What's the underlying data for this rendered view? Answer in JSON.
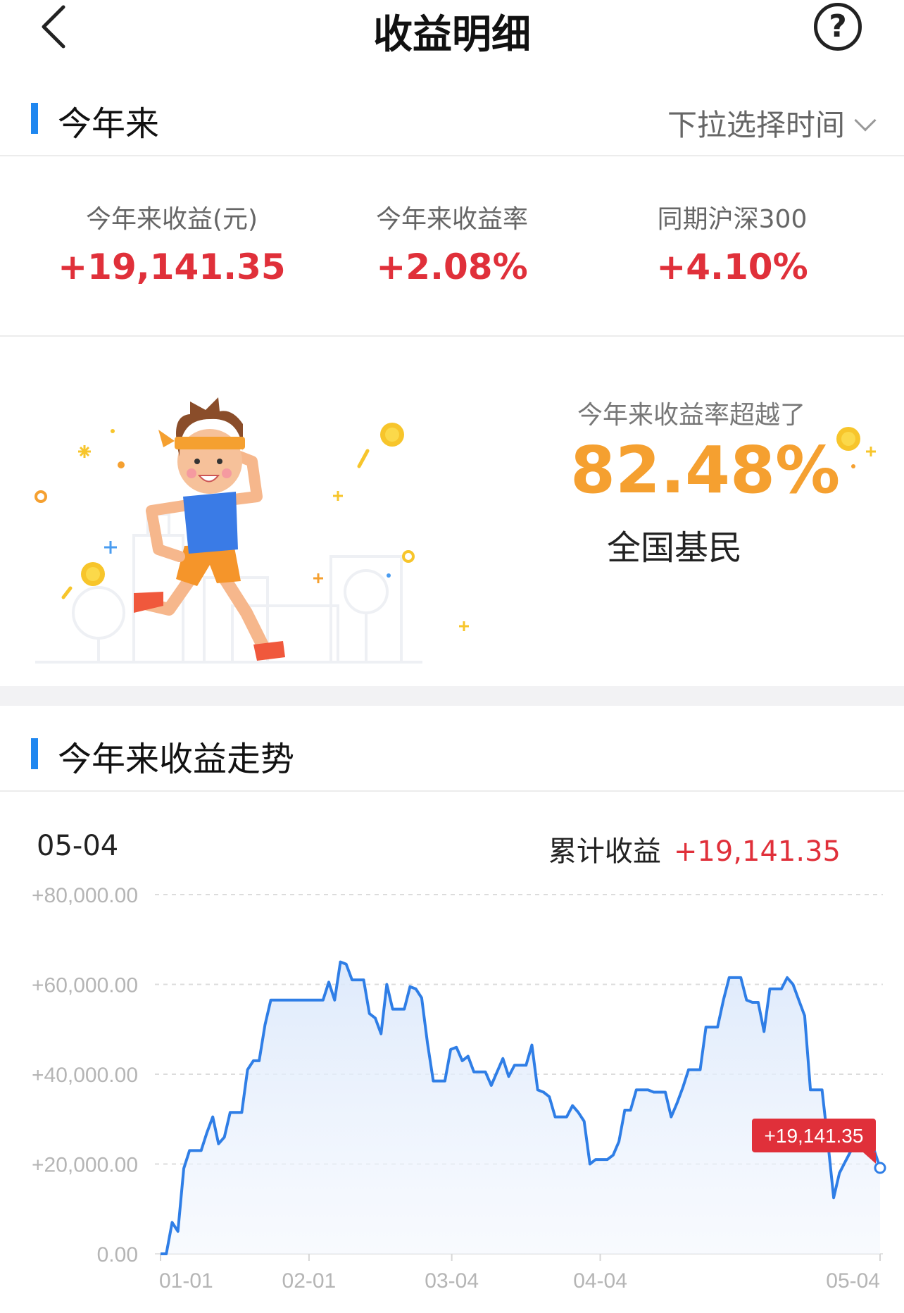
{
  "nav": {
    "title": "收益明细",
    "help_icon": "question-circle-icon",
    "back_icon": "chevron-left-icon"
  },
  "period": {
    "title": "今年来",
    "dropdown_label": "下拉选择时间"
  },
  "stats": [
    {
      "label": "今年来收益(元)",
      "value": "+19,141.35"
    },
    {
      "label": "今年来收益率",
      "value": "+2.08%"
    },
    {
      "label": "同期沪深300",
      "value": "+4.10%"
    }
  ],
  "banner": {
    "label": "今年来收益率超越了",
    "value": "82.48%",
    "sub": "全国基民"
  },
  "trend": {
    "title": "今年来收益走势",
    "date": "05-04",
    "cum_label": "累计收益",
    "cum_value": "+19,141.35",
    "tooltip": "+19,141.35"
  },
  "colors": {
    "accent": "#1f87f0",
    "positive": "#e0303a",
    "highlight": "#f5a030",
    "line": "#2f7ee6"
  },
  "chart_data": {
    "type": "area",
    "x_ticks": [
      "01-01",
      "02-01",
      "03-04",
      "04-04",
      "05-04"
    ],
    "y_ticks": [
      "0.00",
      "+20,000.00",
      "+40,000.00",
      "+60,000.00",
      "+80,000.00"
    ],
    "ylim": [
      0,
      80000
    ],
    "grid": true,
    "values": [
      0,
      0,
      7000,
      5000,
      19000,
      23000,
      23000,
      23000,
      27000,
      30500,
      24500,
      26000,
      31500,
      31500,
      31500,
      41000,
      43000,
      43000,
      51000,
      56500,
      56500,
      56500,
      56500,
      56500,
      56500,
      56500,
      56500,
      56500,
      56500,
      60500,
      56500,
      65000,
      64500,
      61000,
      61000,
      61000,
      53500,
      52500,
      49000,
      60000,
      54500,
      54500,
      54500,
      59500,
      59000,
      57000,
      47000,
      38500,
      38500,
      38500,
      45500,
      46000,
      43000,
      44000,
      40500,
      40500,
      40500,
      37500,
      40500,
      43500,
      39500,
      42000,
      42000,
      42000,
      46500,
      36500,
      36000,
      35000,
      30500,
      30500,
      30500,
      33000,
      31500,
      29500,
      20000,
      21000,
      21000,
      21000,
      22000,
      25000,
      32000,
      32000,
      36500,
      36500,
      36500,
      36000,
      36000,
      36000,
      30500,
      33500,
      37000,
      41000,
      41000,
      41000,
      50500,
      50500,
      50500,
      56500,
      61500,
      61500,
      61500,
      56500,
      56000,
      56000,
      49500,
      59000,
      59000,
      59000,
      61500,
      60000,
      56500,
      53000,
      36500,
      36500,
      36500,
      25000,
      12500,
      18000,
      20500,
      23000,
      23000,
      23000,
      23000,
      23000,
      19141.35
    ]
  }
}
